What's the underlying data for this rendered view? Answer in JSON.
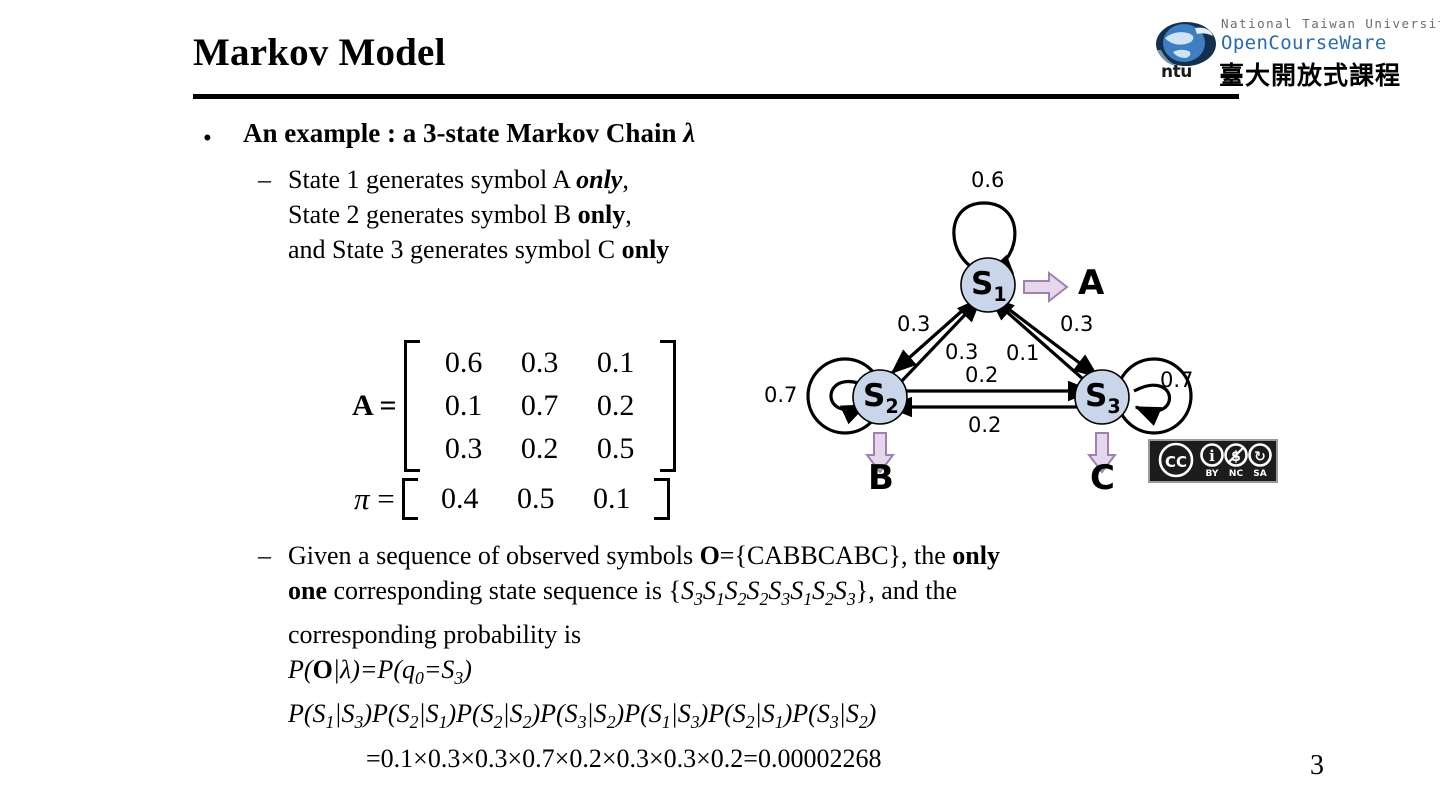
{
  "slide": {
    "title": "Markov Model",
    "page_number": "3"
  },
  "logo": {
    "line1": "National Taiwan University",
    "line2": "OpenCourseWare",
    "line3": "臺大開放式課程",
    "ntu_mark": "ntu",
    "globe_icon": "globe-icon",
    "color_line1": "#6d6d6d",
    "color_line2": "#2a6ab0",
    "color_line3": "#000000"
  },
  "bullets": {
    "level1": {
      "marker": "•",
      "text_plain": "An example : a 3-state Markov Chain λ",
      "text_main": "An example : a 3-state Markov Chain ",
      "lambda": "λ"
    },
    "item1": {
      "marker": "–",
      "line1_a": "State 1 generates symbol A ",
      "line1_b": "only",
      "line1_c": ",",
      "line2_a": "State 2 generates symbol B ",
      "line2_b": "only",
      "line2_c": ",",
      "line3_a": "and State 3 generates symbol C ",
      "line3_b": "only"
    },
    "item2": {
      "marker": "–",
      "line1_a": "Given a sequence of observed symbols ",
      "line1_O": "O",
      "line1_b": "={CABBCABC}, the ",
      "line1_c": "only",
      "line2_a": "one",
      "line2_b": " corresponding state sequence is {",
      "line2_seq": "S3S1S2S2S3S1S2S3",
      "line2_c": "}, and the",
      "line3": "corresponding probability is",
      "line4": "P(O|λ)=P(q0=S3)",
      "line5": "P(S1|S3)P(S2|S1)P(S2|S2)P(S3|S2)P(S1|S3)P(S2|S1)P(S3|S2)",
      "line6": "=0.1×0.3×0.3×0.7×0.2×0.3×0.3×0.2=0.00002268"
    }
  },
  "matrix": {
    "label_A": "A",
    "equals": "=",
    "rows": [
      [
        "0.6",
        "0.3",
        "0.1"
      ],
      [
        "0.1",
        "0.7",
        "0.2"
      ],
      [
        "0.3",
        "0.2",
        "0.5"
      ]
    ],
    "label_pi": "π",
    "pi_values": [
      "0.4",
      "0.5",
      "0.1"
    ]
  },
  "chart_data": {
    "type": "diagram",
    "title": "3-state Markov Chain state-transition diagram",
    "node_fill": "#c9d6ea",
    "node_stroke": "#000000",
    "emission_arrow_fill": "#e6d8ec",
    "emission_arrow_stroke": "#9f80b0",
    "nodes": [
      {
        "id": "S1",
        "label": "S",
        "sub": "1",
        "emits": "A",
        "self_loop": "0.6"
      },
      {
        "id": "S2",
        "label": "S",
        "sub": "2",
        "emits": "B",
        "self_loop": "0.7"
      },
      {
        "id": "S3",
        "label": "S",
        "sub": "3",
        "emits": "C",
        "self_loop": "0.7"
      }
    ],
    "edges": [
      {
        "from": "S1",
        "to": "S2",
        "label": "0.3",
        "position": "outer-left"
      },
      {
        "from": "S2",
        "to": "S1",
        "label": "0.3",
        "position": "inner-left"
      },
      {
        "from": "S1",
        "to": "S3",
        "label": "0.3",
        "position": "outer-right"
      },
      {
        "from": "S3",
        "to": "S1",
        "label": "0.1",
        "position": "inner-right"
      },
      {
        "from": "S2",
        "to": "S3",
        "label": "0.2",
        "position": "upper-horizontal"
      },
      {
        "from": "S3",
        "to": "S2",
        "label": "0.2",
        "position": "lower-horizontal"
      }
    ],
    "emission_symbols": [
      "A",
      "B",
      "C"
    ]
  },
  "cc_badge": {
    "name": "cc-by-nc-sa-icon",
    "cc": "CC",
    "terms": [
      "BY",
      "NC",
      "SA"
    ]
  }
}
